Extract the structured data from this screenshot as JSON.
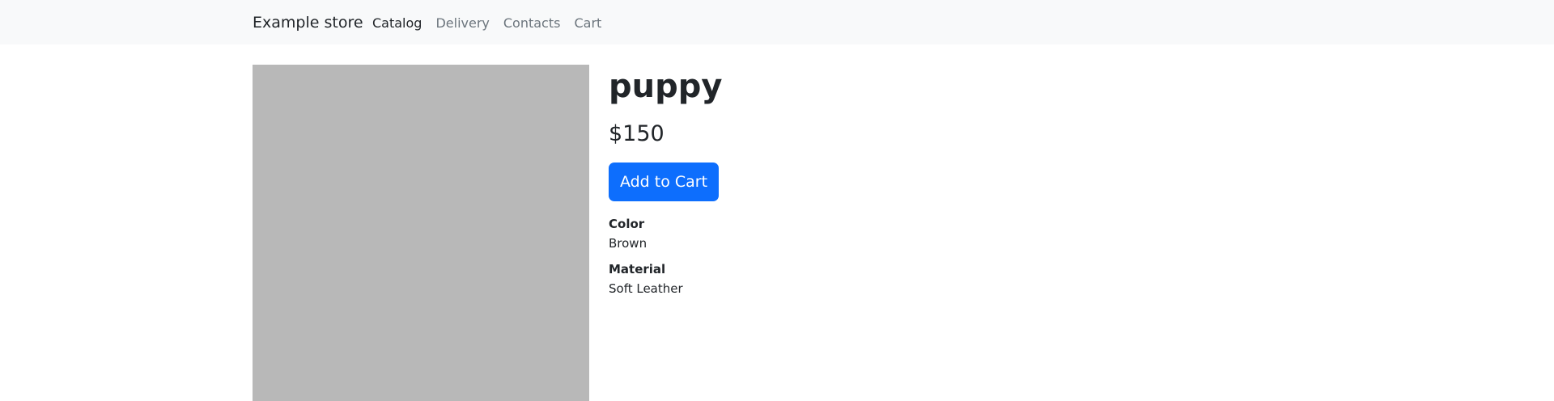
{
  "header": {
    "brand": "Example store",
    "nav": [
      {
        "label": "Catalog",
        "active": true
      },
      {
        "label": "Delivery",
        "active": false
      },
      {
        "label": "Contacts",
        "active": false
      },
      {
        "label": "Cart",
        "active": false
      }
    ]
  },
  "product": {
    "title": "puppy",
    "price": "$150",
    "add_to_cart_label": "Add to Cart",
    "specs": [
      {
        "label": "Color",
        "value": "Brown"
      },
      {
        "label": "Material",
        "value": "Soft Leather"
      }
    ]
  },
  "colors": {
    "navbar_bg": "#f8f9fa",
    "primary": "#0d6efd",
    "image_placeholder": "#b8b8b8",
    "text": "#212529",
    "muted": "#6c757d"
  }
}
